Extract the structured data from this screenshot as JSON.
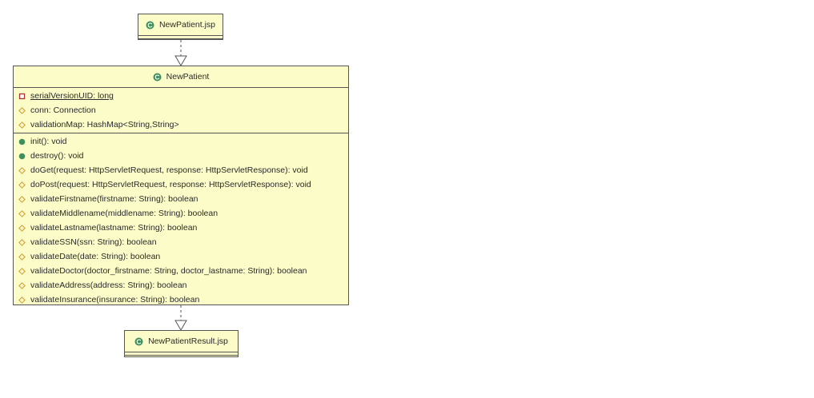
{
  "diagram": {
    "classes": [
      {
        "id": "new-patient-jsp",
        "name": "NewPatient.jsp",
        "stereotype_icon": "class-icon",
        "attributes": [],
        "operations": []
      },
      {
        "id": "new-patient",
        "name": "NewPatient",
        "stereotype_icon": "class-icon",
        "attributes": [
          {
            "text": "serialVersionUID: long",
            "visibility": "private",
            "static": true,
            "icon": "private-square-icon"
          },
          {
            "text": "conn: Connection",
            "visibility": "package",
            "static": false,
            "icon": "package-diamond-icon"
          },
          {
            "text": "validationMap: HashMap<String,String>",
            "visibility": "package",
            "static": false,
            "icon": "package-diamond-icon"
          }
        ],
        "operations": [
          {
            "text": "init(): void",
            "visibility": "public",
            "icon": "public-circle-icon"
          },
          {
            "text": "destroy(): void",
            "visibility": "public",
            "icon": "public-circle-icon"
          },
          {
            "text": "doGet(request: HttpServletRequest, response: HttpServletResponse): void",
            "visibility": "package",
            "icon": "package-diamond-icon"
          },
          {
            "text": "doPost(request: HttpServletRequest, response: HttpServletResponse): void",
            "visibility": "package",
            "icon": "package-diamond-icon"
          },
          {
            "text": "validateFirstname(firstname: String): boolean",
            "visibility": "package",
            "icon": "package-diamond-icon"
          },
          {
            "text": "validateMiddlename(middlename: String): boolean",
            "visibility": "package",
            "icon": "package-diamond-icon"
          },
          {
            "text": "validateLastname(lastname: String): boolean",
            "visibility": "package",
            "icon": "package-diamond-icon"
          },
          {
            "text": "validateSSN(ssn: String): boolean",
            "visibility": "package",
            "icon": "package-diamond-icon"
          },
          {
            "text": "validateDate(date: String): boolean",
            "visibility": "package",
            "icon": "package-diamond-icon"
          },
          {
            "text": "validateDoctor(doctor_firstname: String, doctor_lastname: String): boolean",
            "visibility": "package",
            "icon": "package-diamond-icon"
          },
          {
            "text": "validateAddress(address: String): boolean",
            "visibility": "package",
            "icon": "package-diamond-icon"
          },
          {
            "text": "validateInsurance(insurance: String): boolean",
            "visibility": "package",
            "icon": "package-diamond-icon"
          }
        ]
      },
      {
        "id": "new-patient-result-jsp",
        "name": "NewPatientResult.jsp",
        "stereotype_icon": "class-icon",
        "attributes": [],
        "operations": []
      }
    ],
    "relations": [
      {
        "from": "new-patient-jsp",
        "to": "new-patient",
        "type": "dependency-realization",
        "line": "dashed",
        "head": "hollow-triangle"
      },
      {
        "from": "new-patient",
        "to": "new-patient-result-jsp",
        "type": "dependency-realization",
        "line": "dashed",
        "head": "hollow-triangle"
      }
    ],
    "colors": {
      "box_fill": "#fcfcc8",
      "box_border": "#555555",
      "class_icon": "#3f8f5a",
      "private_icon": "#b03030",
      "package_icon": "#c8a030",
      "public_icon": "#3f8f5a"
    }
  }
}
